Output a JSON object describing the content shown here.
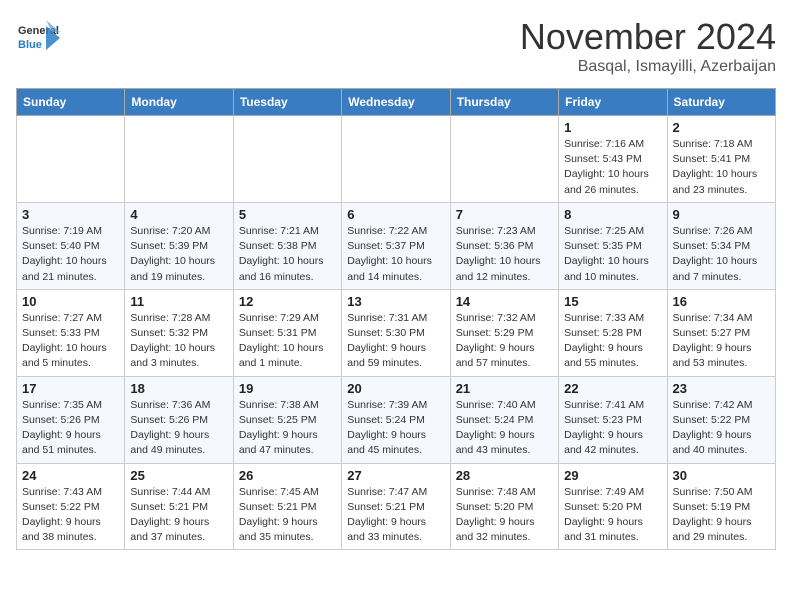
{
  "logo": {
    "general": "General",
    "blue": "Blue"
  },
  "header": {
    "month": "November 2024",
    "location": "Basqal, Ismayilli, Azerbaijan"
  },
  "weekdays": [
    "Sunday",
    "Monday",
    "Tuesday",
    "Wednesday",
    "Thursday",
    "Friday",
    "Saturday"
  ],
  "weeks": [
    [
      {
        "day": "",
        "info": ""
      },
      {
        "day": "",
        "info": ""
      },
      {
        "day": "",
        "info": ""
      },
      {
        "day": "",
        "info": ""
      },
      {
        "day": "",
        "info": ""
      },
      {
        "day": "1",
        "info": "Sunrise: 7:16 AM\nSunset: 5:43 PM\nDaylight: 10 hours and 26 minutes."
      },
      {
        "day": "2",
        "info": "Sunrise: 7:18 AM\nSunset: 5:41 PM\nDaylight: 10 hours and 23 minutes."
      }
    ],
    [
      {
        "day": "3",
        "info": "Sunrise: 7:19 AM\nSunset: 5:40 PM\nDaylight: 10 hours and 21 minutes."
      },
      {
        "day": "4",
        "info": "Sunrise: 7:20 AM\nSunset: 5:39 PM\nDaylight: 10 hours and 19 minutes."
      },
      {
        "day": "5",
        "info": "Sunrise: 7:21 AM\nSunset: 5:38 PM\nDaylight: 10 hours and 16 minutes."
      },
      {
        "day": "6",
        "info": "Sunrise: 7:22 AM\nSunset: 5:37 PM\nDaylight: 10 hours and 14 minutes."
      },
      {
        "day": "7",
        "info": "Sunrise: 7:23 AM\nSunset: 5:36 PM\nDaylight: 10 hours and 12 minutes."
      },
      {
        "day": "8",
        "info": "Sunrise: 7:25 AM\nSunset: 5:35 PM\nDaylight: 10 hours and 10 minutes."
      },
      {
        "day": "9",
        "info": "Sunrise: 7:26 AM\nSunset: 5:34 PM\nDaylight: 10 hours and 7 minutes."
      }
    ],
    [
      {
        "day": "10",
        "info": "Sunrise: 7:27 AM\nSunset: 5:33 PM\nDaylight: 10 hours and 5 minutes."
      },
      {
        "day": "11",
        "info": "Sunrise: 7:28 AM\nSunset: 5:32 PM\nDaylight: 10 hours and 3 minutes."
      },
      {
        "day": "12",
        "info": "Sunrise: 7:29 AM\nSunset: 5:31 PM\nDaylight: 10 hours and 1 minute."
      },
      {
        "day": "13",
        "info": "Sunrise: 7:31 AM\nSunset: 5:30 PM\nDaylight: 9 hours and 59 minutes."
      },
      {
        "day": "14",
        "info": "Sunrise: 7:32 AM\nSunset: 5:29 PM\nDaylight: 9 hours and 57 minutes."
      },
      {
        "day": "15",
        "info": "Sunrise: 7:33 AM\nSunset: 5:28 PM\nDaylight: 9 hours and 55 minutes."
      },
      {
        "day": "16",
        "info": "Sunrise: 7:34 AM\nSunset: 5:27 PM\nDaylight: 9 hours and 53 minutes."
      }
    ],
    [
      {
        "day": "17",
        "info": "Sunrise: 7:35 AM\nSunset: 5:26 PM\nDaylight: 9 hours and 51 minutes."
      },
      {
        "day": "18",
        "info": "Sunrise: 7:36 AM\nSunset: 5:26 PM\nDaylight: 9 hours and 49 minutes."
      },
      {
        "day": "19",
        "info": "Sunrise: 7:38 AM\nSunset: 5:25 PM\nDaylight: 9 hours and 47 minutes."
      },
      {
        "day": "20",
        "info": "Sunrise: 7:39 AM\nSunset: 5:24 PM\nDaylight: 9 hours and 45 minutes."
      },
      {
        "day": "21",
        "info": "Sunrise: 7:40 AM\nSunset: 5:24 PM\nDaylight: 9 hours and 43 minutes."
      },
      {
        "day": "22",
        "info": "Sunrise: 7:41 AM\nSunset: 5:23 PM\nDaylight: 9 hours and 42 minutes."
      },
      {
        "day": "23",
        "info": "Sunrise: 7:42 AM\nSunset: 5:22 PM\nDaylight: 9 hours and 40 minutes."
      }
    ],
    [
      {
        "day": "24",
        "info": "Sunrise: 7:43 AM\nSunset: 5:22 PM\nDaylight: 9 hours and 38 minutes."
      },
      {
        "day": "25",
        "info": "Sunrise: 7:44 AM\nSunset: 5:21 PM\nDaylight: 9 hours and 37 minutes."
      },
      {
        "day": "26",
        "info": "Sunrise: 7:45 AM\nSunset: 5:21 PM\nDaylight: 9 hours and 35 minutes."
      },
      {
        "day": "27",
        "info": "Sunrise: 7:47 AM\nSunset: 5:21 PM\nDaylight: 9 hours and 33 minutes."
      },
      {
        "day": "28",
        "info": "Sunrise: 7:48 AM\nSunset: 5:20 PM\nDaylight: 9 hours and 32 minutes."
      },
      {
        "day": "29",
        "info": "Sunrise: 7:49 AM\nSunset: 5:20 PM\nDaylight: 9 hours and 31 minutes."
      },
      {
        "day": "30",
        "info": "Sunrise: 7:50 AM\nSunset: 5:19 PM\nDaylight: 9 hours and 29 minutes."
      }
    ]
  ]
}
